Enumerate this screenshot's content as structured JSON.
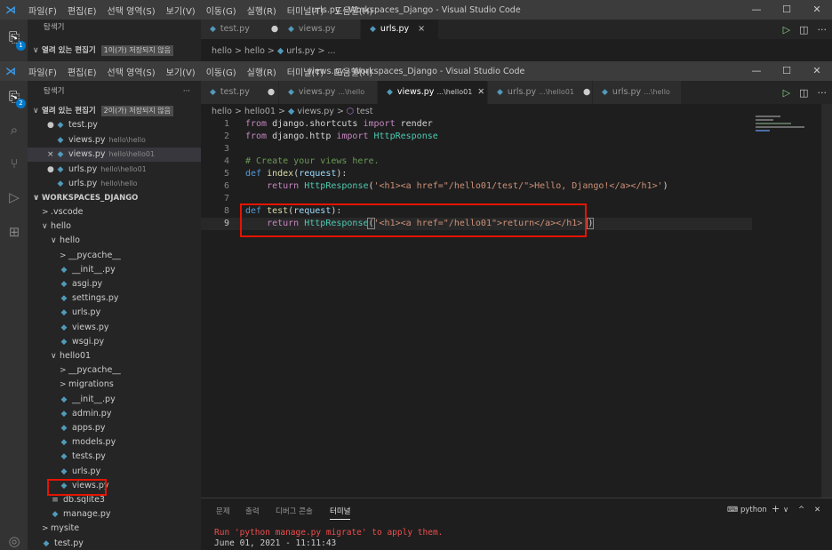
{
  "back_window": {
    "menu": [
      "파일(F)",
      "편집(E)",
      "선택 영역(S)",
      "보기(V)",
      "이동(G)",
      "실행(R)",
      "터미널(T)",
      "도움말(H)"
    ],
    "title": "urls.py - Workspaces_Django - Visual Studio Code",
    "explorer_title": "탐색기",
    "open_editors_label": "열려 있는 편집기",
    "unsaved_badge": "1이(가) 저장되지 않음",
    "tabs": [
      {
        "label": "test.py",
        "state": "●"
      },
      {
        "label": "views.py",
        "state": ""
      },
      {
        "label": "urls.py",
        "state": "×",
        "active": true
      }
    ],
    "breadcrumb": "hello > hello > ",
    "breadcrumb_file": "urls.py > ...",
    "badge": "1"
  },
  "front_window": {
    "menu": [
      "파일(F)",
      "편집(E)",
      "선택 영역(S)",
      "보기(V)",
      "이동(G)",
      "실행(R)",
      "터미널(T)",
      "도움말(H)"
    ],
    "title": "views.py - Workspaces_Django - Visual Studio Code",
    "controls": [
      "—",
      "☐",
      "✕"
    ],
    "badge": "2",
    "explorer_title": "탐색기",
    "explorer_more": "···",
    "open_editors_label": "열려 있는 편집기",
    "unsaved_badge": "2이(가) 저장되지 않음",
    "open_editors": [
      {
        "mark": "●",
        "name": "test.py",
        "path": ""
      },
      {
        "mark": "",
        "name": "views.py",
        "path": "hello\\hello"
      },
      {
        "mark": "×",
        "name": "views.py",
        "path": "hello\\hello01"
      },
      {
        "mark": "●",
        "name": "urls.py",
        "path": "hello\\hello01"
      },
      {
        "mark": "",
        "name": "urls.py",
        "path": "hello\\hello"
      }
    ],
    "workspace_label": "WORKSPACES_DJANGO",
    "tree": [
      {
        "twisty": ">",
        "name": ".vscode",
        "type": "folder",
        "indent": 0
      },
      {
        "twisty": "∨",
        "name": "hello",
        "type": "folder",
        "indent": 0
      },
      {
        "twisty": "∨",
        "name": "hello",
        "type": "folder",
        "indent": 1
      },
      {
        "twisty": ">",
        "name": "__pycache__",
        "type": "folder",
        "indent": 2
      },
      {
        "twisty": "",
        "name": "__init__.py",
        "type": "py",
        "indent": 2
      },
      {
        "twisty": "",
        "name": "asgi.py",
        "type": "py",
        "indent": 2
      },
      {
        "twisty": "",
        "name": "settings.py",
        "type": "py",
        "indent": 2
      },
      {
        "twisty": "",
        "name": "urls.py",
        "type": "py",
        "indent": 2
      },
      {
        "twisty": "",
        "name": "views.py",
        "type": "py",
        "indent": 2
      },
      {
        "twisty": "",
        "name": "wsgi.py",
        "type": "py",
        "indent": 2
      },
      {
        "twisty": "∨",
        "name": "hello01",
        "type": "folder",
        "indent": 1
      },
      {
        "twisty": ">",
        "name": "__pycache__",
        "type": "folder",
        "indent": 2
      },
      {
        "twisty": ">",
        "name": "migrations",
        "type": "folder",
        "indent": 2
      },
      {
        "twisty": "",
        "name": "__init__.py",
        "type": "py",
        "indent": 2
      },
      {
        "twisty": "",
        "name": "admin.py",
        "type": "py",
        "indent": 2
      },
      {
        "twisty": "",
        "name": "apps.py",
        "type": "py",
        "indent": 2
      },
      {
        "twisty": "",
        "name": "models.py",
        "type": "py",
        "indent": 2
      },
      {
        "twisty": "",
        "name": "tests.py",
        "type": "py",
        "indent": 2
      },
      {
        "twisty": "",
        "name": "urls.py",
        "type": "py",
        "indent": 2
      },
      {
        "twisty": "",
        "name": "views.py",
        "type": "py",
        "indent": 2,
        "highlight": true
      },
      {
        "twisty": "",
        "name": "db.sqlite3",
        "type": "db",
        "indent": 1
      },
      {
        "twisty": "",
        "name": "manage.py",
        "type": "py",
        "indent": 1
      },
      {
        "twisty": ">",
        "name": "mysite",
        "type": "folder",
        "indent": 0
      },
      {
        "twisty": "",
        "name": "test.py",
        "type": "py",
        "indent": 0
      }
    ],
    "tabs": [
      {
        "label": "test.py",
        "sub": "",
        "state": "●"
      },
      {
        "label": "views.py",
        "sub": "...\\hello",
        "state": ""
      },
      {
        "label": "views.py",
        "sub": "...\\hello01",
        "state": "✕",
        "active": true
      },
      {
        "label": "urls.py",
        "sub": "...\\hello01",
        "state": "●"
      },
      {
        "label": "urls.py",
        "sub": "...\\hello",
        "state": ""
      }
    ],
    "breadcrumb": [
      "hello",
      "hello01",
      "views.py",
      "test"
    ],
    "code": {
      "line_numbers": [
        "1",
        "2",
        "3",
        "4",
        "5",
        "6",
        "7",
        "8",
        "9"
      ],
      "l1": {
        "a": "from",
        "b": " django.shortcuts ",
        "c": "import",
        "d": " render"
      },
      "l2": {
        "a": "from",
        "b": " django.http ",
        "c": "import",
        "d": " HttpResponse"
      },
      "l4": "# Create your views here.",
      "l5": {
        "a": "def",
        "b": " index",
        "c": "(",
        "d": "request",
        "e": "):"
      },
      "l6": {
        "a": "    return ",
        "b": "HttpResponse",
        "c": "(",
        "d": "'<h1><a href=\"/hello01/test/\">Hello, Django!</a></h1>'",
        "e": ")"
      },
      "l8": {
        "a": "def",
        "b": " test",
        "c": "(",
        "d": "request",
        "e": "):"
      },
      "l9": {
        "a": "    return ",
        "b": "HttpResponse",
        "c": "(",
        "d": "'<h1><a href=\"/hello01\">return</a></h1>'",
        "e": ")"
      }
    },
    "panel": {
      "tabs": [
        "문제",
        "출력",
        "디버그 콘솔",
        "터미널"
      ],
      "active_tab": "터미널",
      "terminal_name": "python",
      "actions": [
        "+",
        "∨",
        "^",
        "✕"
      ],
      "lines": [
        "Run 'python manage.py migrate' to apply them.",
        "June 01, 2021 - 11:11:43"
      ]
    }
  },
  "colors": {
    "highlight": "#e51400",
    "accent": "#007acc"
  }
}
